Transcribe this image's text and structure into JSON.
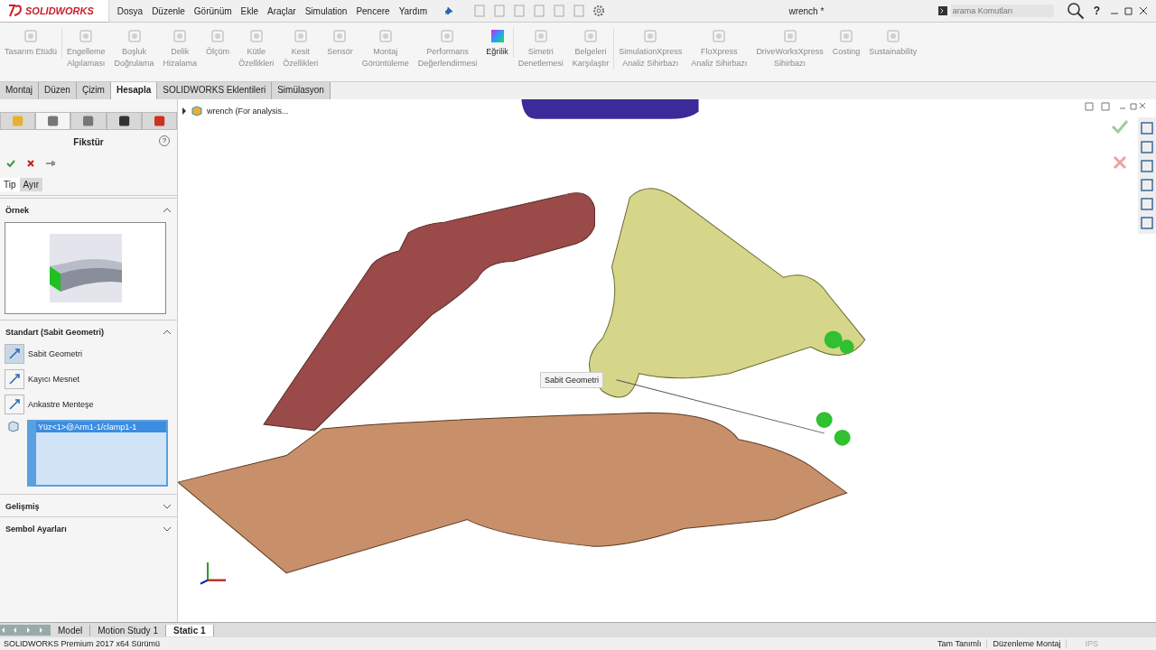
{
  "app": {
    "logo": "SOLIDWORKS",
    "title": "wrench *"
  },
  "menu": [
    "Dosya",
    "Düzenle",
    "Görünüm",
    "Ekle",
    "Araçlar",
    "Simulation",
    "Pencere",
    "Yardım"
  ],
  "search": {
    "placeholder": "arama Komutları"
  },
  "help": "?",
  "ribbon": [
    {
      "lines": [
        "Tasarım Etüdü"
      ],
      "disabled": true,
      "kind": "dropdown"
    },
    {
      "lines": [
        "Engelleme",
        "Algılaması"
      ],
      "disabled": true,
      "kind": "tool"
    },
    {
      "lines": [
        "Boşluk",
        "Doğrulama"
      ],
      "disabled": true,
      "kind": "tool"
    },
    {
      "lines": [
        "Delik",
        "Hizalama"
      ],
      "disabled": true,
      "kind": "tool"
    },
    {
      "lines": [
        "Ölçüm"
      ],
      "disabled": true,
      "kind": "tool"
    },
    {
      "lines": [
        "Kütle",
        "Özellikleri"
      ],
      "disabled": true,
      "kind": "tool"
    },
    {
      "lines": [
        "Kesit",
        "Özellikleri"
      ],
      "disabled": true,
      "kind": "tool"
    },
    {
      "lines": [
        "Sensör"
      ],
      "disabled": true,
      "kind": "tool"
    },
    {
      "lines": [
        "Montaj",
        "Görüntüleme"
      ],
      "disabled": true,
      "kind": "tool"
    },
    {
      "lines": [
        "Performans",
        "Değerlendirmesi"
      ],
      "disabled": true,
      "kind": "tool"
    },
    {
      "lines": [
        "Eğrilik"
      ],
      "disabled": false,
      "kind": "color"
    },
    {
      "lines": [
        "Simetri",
        "Denetlemesi"
      ],
      "disabled": true,
      "kind": "tool"
    },
    {
      "lines": [
        "Belgeleri",
        "Karşılaştır"
      ],
      "disabled": true,
      "kind": "tool"
    },
    {
      "lines": [
        "SimulationXpress",
        "Analiz Sihirbazı"
      ],
      "disabled": true,
      "kind": "tool"
    },
    {
      "lines": [
        "FloXpress",
        "Analiz Sihirbazı"
      ],
      "disabled": true,
      "kind": "tool"
    },
    {
      "lines": [
        "DriveWorksXpress",
        "Sihirbazı"
      ],
      "disabled": true,
      "kind": "tool"
    },
    {
      "lines": [
        "Costing"
      ],
      "disabled": true,
      "kind": "tool"
    },
    {
      "lines": [
        "Sustainability"
      ],
      "disabled": true,
      "kind": "tool"
    }
  ],
  "command_tabs": [
    {
      "label": "Montaj",
      "selected": false
    },
    {
      "label": "Düzen",
      "selected": false
    },
    {
      "label": "Çizim",
      "selected": false
    },
    {
      "label": "Hesapla",
      "selected": true
    },
    {
      "label": "SOLIDWORKS Eklentileri",
      "selected": false
    },
    {
      "label": "Simülasyon",
      "selected": false
    }
  ],
  "panel": {
    "title": "Fikstür",
    "help": "?",
    "sub_tabs": [
      {
        "label": "Tip",
        "selected": true
      },
      {
        "label": "Ayır",
        "selected": false
      }
    ],
    "example": {
      "title": "Örnek",
      "expanded": true
    },
    "standard": {
      "title": "Standart (Sabit Geometri)",
      "expanded": true,
      "types": [
        {
          "label": "Sabit Geometri",
          "selected": true
        },
        {
          "label": "Kayıcı Mesnet",
          "selected": false
        },
        {
          "label": "Ankastre Menteşe",
          "selected": false
        }
      ],
      "selection": [
        {
          "label": "Yüz<1>@Arm1-1/clamp1-1",
          "selected": true
        }
      ]
    },
    "sections": [
      {
        "title": "Gelişmiş",
        "expanded": false
      },
      {
        "title": "Sembol Ayarları",
        "expanded": false
      }
    ]
  },
  "tree": {
    "label": "wrench  (For analysis...",
    "expanded": false
  },
  "callout": "Sabit Geometri",
  "bottom_tabs": [
    {
      "label": "Model",
      "selected": false
    },
    {
      "label": "Motion Study 1",
      "selected": false
    },
    {
      "label": "Static 1",
      "selected": true
    }
  ],
  "status_bar": {
    "version": "SOLIDWORKS Premium 2017 x64 Sürümü",
    "state": "Tam Tanımlı",
    "mode": "Düzenleme Montaj",
    "units": "IPS"
  }
}
